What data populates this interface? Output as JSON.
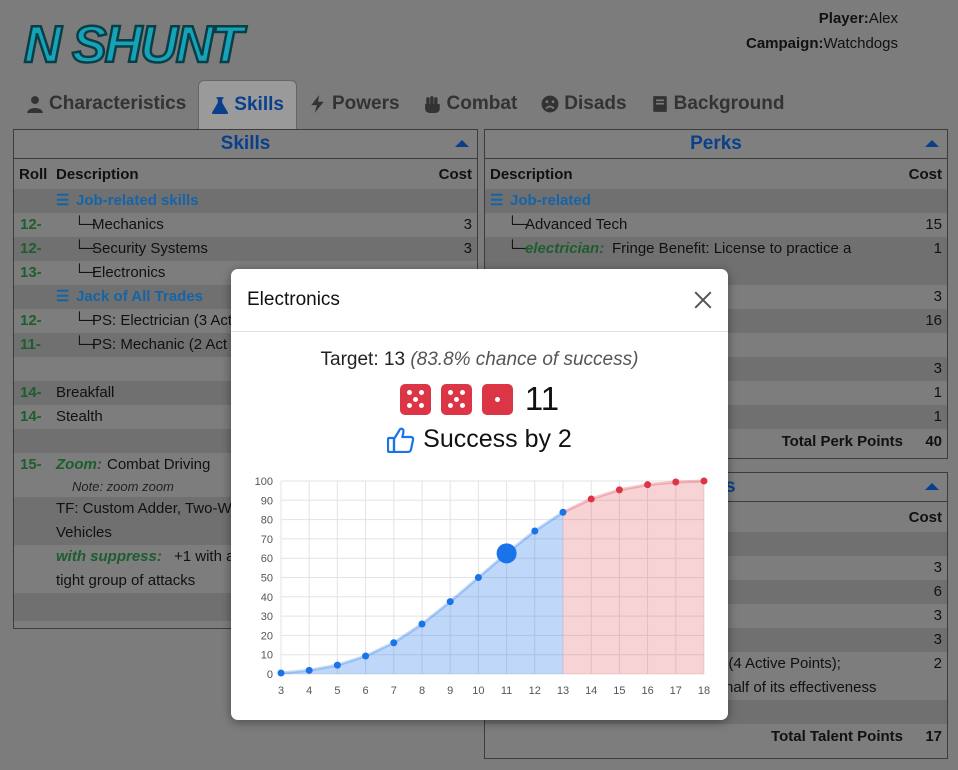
{
  "app": {
    "logo_text": "N SHUNT"
  },
  "player": {
    "player_label": "Player:",
    "player_name": "Alex",
    "campaign_label": "Campaign:",
    "campaign_name": "Watchdogs"
  },
  "tabs": [
    {
      "label": "Characteristics",
      "icon": "user-icon"
    },
    {
      "label": "Skills",
      "icon": "flask-icon"
    },
    {
      "label": "Powers",
      "icon": "bolt-icon"
    },
    {
      "label": "Combat",
      "icon": "fist-icon"
    },
    {
      "label": "Disads",
      "icon": "frown-icon"
    },
    {
      "label": "Background",
      "icon": "book-icon"
    }
  ],
  "skills_panel": {
    "title": "Skills",
    "col_roll": "Roll",
    "col_desc": "Description",
    "col_cost": "Cost",
    "rows": [
      {
        "roll": "",
        "desc": "Job-related skills",
        "cost": ""
      },
      {
        "roll": "12-",
        "desc": "Mechanics",
        "cost": "3"
      },
      {
        "roll": "12-",
        "desc": "Security Systems",
        "cost": "3"
      },
      {
        "roll": "13-",
        "desc": "Electronics",
        "cost": ""
      },
      {
        "roll": "",
        "desc": "Jack of All Trades",
        "cost": ""
      },
      {
        "roll": "12-",
        "desc": "PS: Electrician (3 Act",
        "cost": ""
      },
      {
        "roll": "11-",
        "desc": "PS: Mechanic (2 Act",
        "cost": ""
      },
      {
        "roll": "",
        "desc": "",
        "cost": ""
      },
      {
        "roll": "14-",
        "desc": "Breakfall",
        "cost": ""
      },
      {
        "roll": "14-",
        "desc": "Stealth",
        "cost": ""
      },
      {
        "roll": "",
        "desc": "",
        "cost": ""
      },
      {
        "roll": "15-",
        "talent": "Zoom:",
        "desc": "Combat Driving",
        "cost": ""
      },
      {
        "note": "Note: zoom zoom"
      },
      {
        "desc": "TF: Custom Adder, Two-W"
      },
      {
        "desc": "Vehicles"
      },
      {
        "talent": "with suppress:",
        "desc": "+1 with a"
      },
      {
        "desc": "tight group of attacks"
      }
    ]
  },
  "perks_panel": {
    "title": "Perks",
    "col_desc": "Description",
    "col_cost": "Cost",
    "rows": [
      {
        "desc": "Job-related",
        "cost": ""
      },
      {
        "desc": "Advanced Tech",
        "cost": "15"
      },
      {
        "talent": "electrician:",
        "desc": "Fringe Benefit: License to practice a",
        "cost": "1"
      },
      {
        "desc": "",
        "cost": ""
      },
      {
        "desc": "",
        "cost": "3"
      },
      {
        "desc": "",
        "cost": "16"
      },
      {
        "desc": "",
        "cost": ""
      },
      {
        "desc": "",
        "cost": "3"
      },
      {
        "desc": "",
        "cost": "1"
      },
      {
        "desc": "",
        "cost": "1"
      }
    ],
    "total_label": "Total Perk Points",
    "total_value": "40"
  },
  "talents_panel": {
    "title_tail": "s",
    "col_cost": "Cost",
    "costs": [
      "",
      "3",
      "6",
      "3",
      "3"
    ],
    "frag1": "t) (4 Active Points);",
    "frag1_cost": "2",
    "frag2": "half of its effectiveness",
    "total_label": "Total Talent Points",
    "total_value": "17"
  },
  "modal": {
    "title": "Electronics",
    "target_label": "Target:",
    "target_value": "13",
    "chance_text": "(83.8% chance of success)",
    "dice": [
      5,
      5,
      1
    ],
    "dice_total": "11",
    "result_text": "Success by 2",
    "result_icon": "thumbs-up-icon"
  },
  "colors": {
    "accent": "#0a3f8c",
    "success": "#1c5e2e",
    "group": "#1664a8",
    "die": "#dc3545",
    "chart_success": "#1a73e8",
    "chart_fail": "#dc3545"
  },
  "chart_data": {
    "type": "area",
    "x": [
      3,
      4,
      5,
      6,
      7,
      8,
      9,
      10,
      11,
      12,
      13,
      14,
      15,
      16,
      17,
      18
    ],
    "y": [
      0.5,
      1.9,
      4.6,
      9.3,
      16.2,
      25.9,
      37.5,
      50,
      62.5,
      74.1,
      83.8,
      90.7,
      95.4,
      98.1,
      99.5,
      100
    ],
    "xlim": [
      3,
      18
    ],
    "ylim": [
      0,
      100
    ],
    "yticks": [
      0,
      10,
      20,
      30,
      40,
      50,
      60,
      70,
      80,
      90,
      100
    ],
    "target": 13,
    "roll": 11,
    "grid": true
  }
}
